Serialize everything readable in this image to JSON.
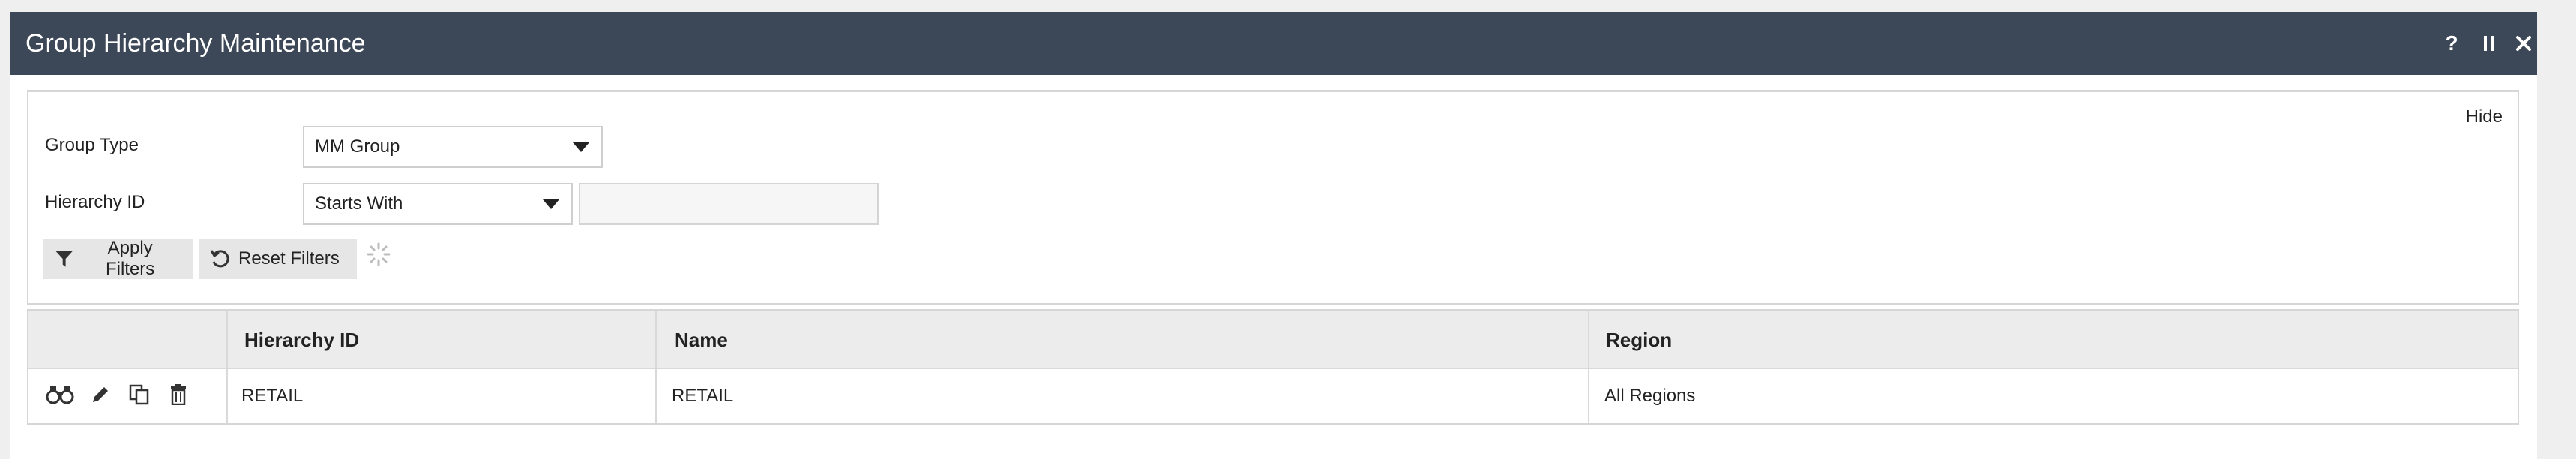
{
  "window": {
    "title": "Group Hierarchy Maintenance",
    "help_label": "?",
    "pause_label": "II",
    "close_label": "✕"
  },
  "filters": {
    "hide_label": "Hide",
    "group_type": {
      "label": "Group Type",
      "selected": "MM Group"
    },
    "hierarchy_id": {
      "label": "Hierarchy ID",
      "operator": "Starts With",
      "value": "",
      "placeholder": ""
    },
    "apply_label": "Apply Filters",
    "reset_label": "Reset Filters"
  },
  "table": {
    "columns": [
      "",
      "Hierarchy ID",
      "Name",
      "Region"
    ],
    "rows": [
      {
        "actions": [
          "view-icon",
          "edit-icon",
          "copy-icon",
          "delete-icon"
        ],
        "hierarchy_id": "RETAIL",
        "name": "RETAIL",
        "region": "All Regions"
      }
    ]
  },
  "colors": {
    "titlebar_bg": "#3c4858",
    "page_bg": "#efefef",
    "button_bg": "#e6e6e6",
    "header_bg": "#ececec"
  }
}
